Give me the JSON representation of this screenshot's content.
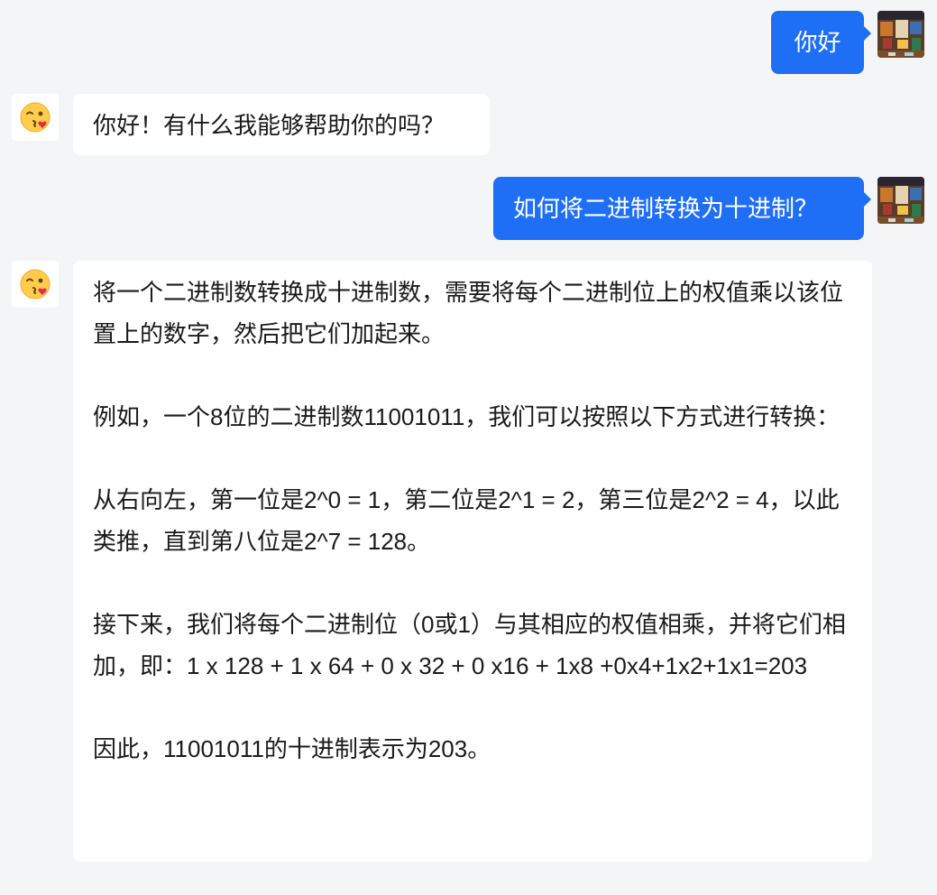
{
  "conversation": {
    "messages": [
      {
        "role": "user",
        "text": "你好"
      },
      {
        "role": "assistant",
        "text": "你好！有什么我能够帮助你的吗？"
      },
      {
        "role": "user",
        "text": "如何将二进制转换为十进制？"
      },
      {
        "role": "assistant",
        "paragraphs": [
          "将一个二进制数转换成十进制数，需要将每个二进制位上的权值乘以该位置上的数字，然后把它们加起来。",
          "例如，一个8位的二进制数11001011，我们可以按照以下方式进行转换：",
          "从右向左，第一位是2^0 = 1，第二位是2^1 = 2，第三位是2^2 = 4，以此类推，直到第八位是2^7 = 128。",
          "接下来，我们将每个二进制位（0或1）与其相应的权值相乘，并将它们相加，即：1 x 128 + 1 x 64 + 0 x 32 + 0 x16 + 1x8 +0x4+1x2+1x1=203",
          "因此，11001011的十进制表示为203。"
        ]
      }
    ]
  },
  "avatars": {
    "user_icon": "user-avatar-icon",
    "assistant_icon": "kissing-face-emoji-icon"
  },
  "colors": {
    "background": "#f4f5f7",
    "user_bubble": "#1e6ff5",
    "assistant_bubble": "#ffffff",
    "text": "#1a1a1a"
  }
}
